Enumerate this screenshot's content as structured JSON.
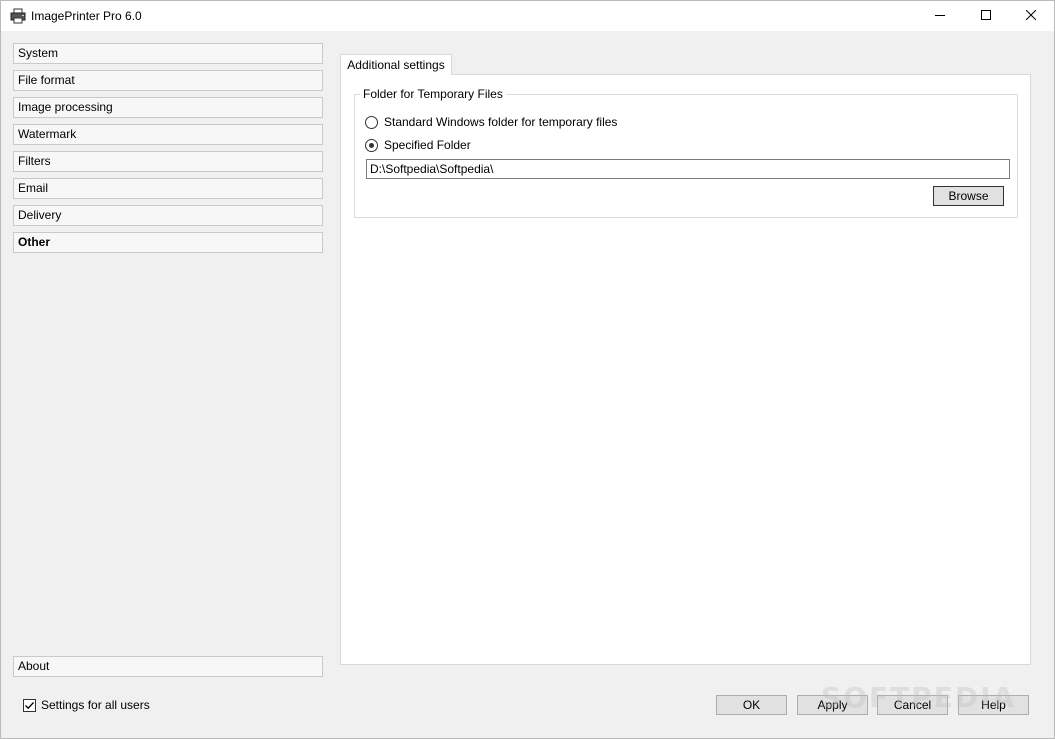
{
  "window": {
    "title": "ImagePrinter Pro 6.0"
  },
  "sidebar": {
    "items": [
      {
        "label": "System"
      },
      {
        "label": "File format"
      },
      {
        "label": "Image processing"
      },
      {
        "label": "Watermark"
      },
      {
        "label": "Filters"
      },
      {
        "label": "Email"
      },
      {
        "label": "Delivery"
      },
      {
        "label": "Other",
        "selected": true
      }
    ],
    "about_label": "About",
    "all_users_checkbox": {
      "label": "Settings for all users",
      "checked": true
    }
  },
  "tabs": [
    {
      "label": "Additional settings",
      "active": true
    }
  ],
  "temp_folder": {
    "group_label": "Folder for Temporary Files",
    "options": [
      {
        "label": "Standard Windows folder for temporary files",
        "checked": false
      },
      {
        "label": "Specified Folder",
        "checked": true
      }
    ],
    "path_value": "D:\\Softpedia\\Softpedia\\",
    "browse_label": "Browse"
  },
  "footer": {
    "ok_label": "OK",
    "apply_label": "Apply",
    "cancel_label": "Cancel",
    "help_label": "Help"
  },
  "watermark_text": "SOFTPEDIA",
  "icons": {
    "app": "printer-icon",
    "minimize": "minimize-icon",
    "maximize": "maximize-icon",
    "close": "close-icon",
    "check": "checkmark-icon"
  }
}
